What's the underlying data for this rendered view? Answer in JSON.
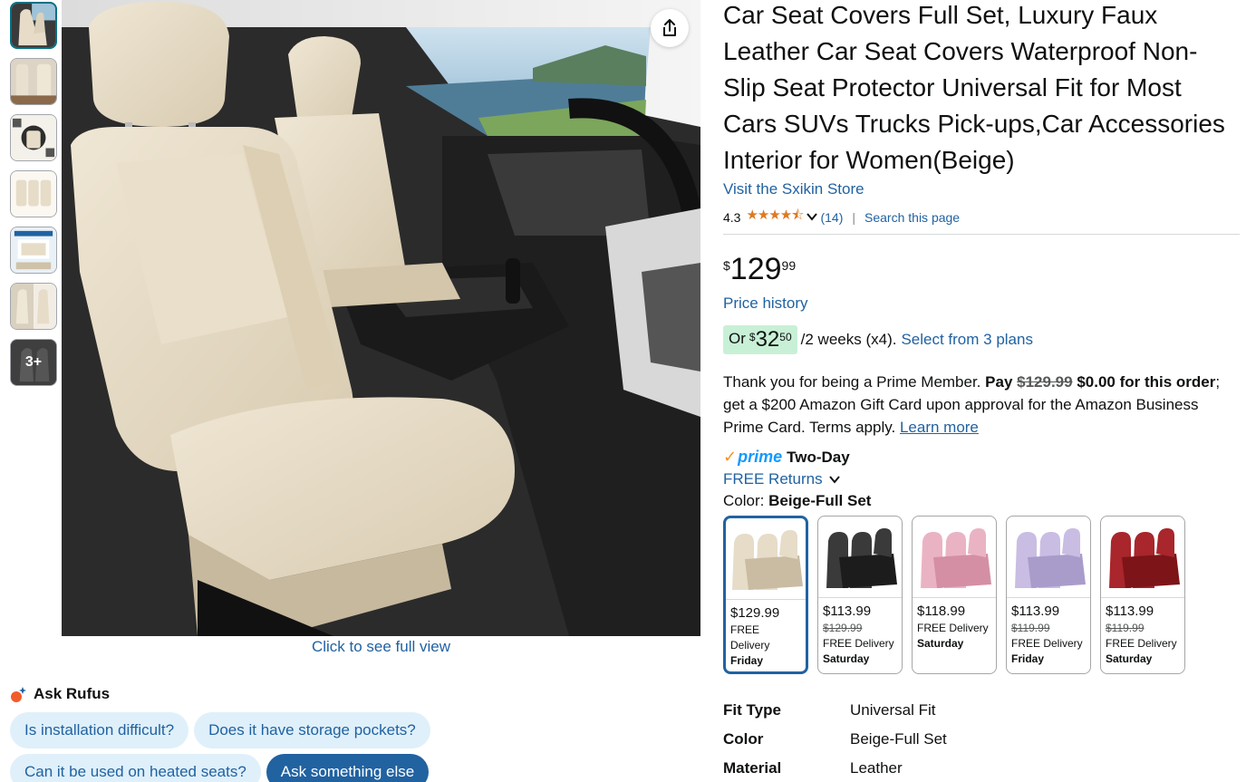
{
  "thumbnails": [
    {
      "name": "thumb-1"
    },
    {
      "name": "thumb-2"
    },
    {
      "name": "thumb-3"
    },
    {
      "name": "thumb-4"
    },
    {
      "name": "thumb-5"
    },
    {
      "name": "thumb-6"
    }
  ],
  "more_thumbs_label": "3+",
  "full_view_label": "Click to see full view",
  "rufus": {
    "title": "Ask Rufus",
    "chips": [
      "Is installation difficult?",
      "Does it have storage pockets?",
      "Can it be used on heated seats?"
    ],
    "ask_label": "Ask something else"
  },
  "product": {
    "title": "Car Seat Covers Full Set, Luxury Faux Leather Car Seat Covers Waterproof Non-Slip Seat Protector Universal Fit for Most Cars SUVs Trucks Pick-ups,Car Accessories Interior for Women(Beige)",
    "store_link": "Visit the Sxikin Store",
    "rating": "4.3",
    "stars": "★★★★⯪",
    "rating_count": "(14)",
    "search_page": "Search this page",
    "price_symbol": "$",
    "price_whole": "129",
    "price_fraction": "99",
    "price_history": "Price history",
    "installment": {
      "prefix": "Or",
      "symbol": "$",
      "whole": "32",
      "fraction": "50",
      "rest": "/2 weeks (x4).",
      "link": "Select from 3 plans"
    },
    "prime_msg": {
      "intro": "Thank you for being a Prime Member.",
      "pay": "Pay",
      "old_price": "$129.99",
      "new_price": "$0.00 for this order",
      "rest": "; get a $200 Amazon Gift Card upon approval for the Amazon Business Prime Card. Terms apply.",
      "learn_more": "Learn more"
    },
    "prime_label": "prime",
    "two_day": "Two-Day",
    "free_returns": "FREE Returns",
    "color_label": "Color:",
    "color_value": "Beige-Full Set"
  },
  "swatches": [
    {
      "price": "$129.99",
      "old": "",
      "delivery": "FREE Delivery",
      "day": "Friday",
      "color": "#e6dcc8",
      "shade": "#c9bca3"
    },
    {
      "price": "$113.99",
      "old": "$129.99",
      "delivery": "FREE Delivery",
      "day": "Saturday",
      "color": "#3a3a3a",
      "shade": "#1c1c1c"
    },
    {
      "price": "$118.99",
      "old": "",
      "delivery": "FREE Delivery",
      "day": "Saturday",
      "color": "#eab3c4",
      "shade": "#d48fa4"
    },
    {
      "price": "$113.99",
      "old": "$119.99",
      "delivery": "FREE Delivery",
      "day": "Friday",
      "color": "#c9bde3",
      "shade": "#a99ccb"
    },
    {
      "price": "$113.99",
      "old": "$119.99",
      "delivery": "FREE Delivery",
      "day": "Saturday",
      "color": "#a8262c",
      "shade": "#7d1418"
    }
  ],
  "specs": [
    {
      "key": "Fit Type",
      "value": "Universal Fit"
    },
    {
      "key": "Color",
      "value": "Beige-Full Set"
    },
    {
      "key": "Material",
      "value": "Leather"
    }
  ]
}
